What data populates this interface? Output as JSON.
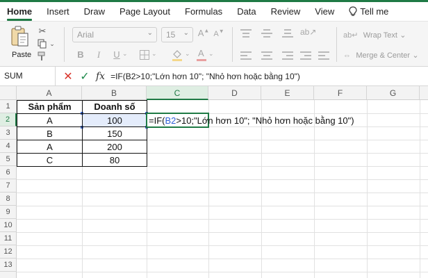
{
  "tabs": [
    "Home",
    "Insert",
    "Draw",
    "Page Layout",
    "Formulas",
    "Data",
    "Review",
    "View"
  ],
  "tell_me": "Tell me",
  "ribbon": {
    "paste_label": "Paste",
    "font_name": "Arial",
    "font_size": "15",
    "bold": "B",
    "italic": "I",
    "underline": "U",
    "wrap_text": "Wrap Text",
    "merge_center": "Merge & Center"
  },
  "formula_bar": {
    "name_box": "SUM",
    "fx": "fx",
    "formula": "=IF(B2>10;\"Lớn hơn 10\"; \"Nhỏ hơn hoặc bằng 10\")"
  },
  "columns": [
    "A",
    "B",
    "C",
    "D",
    "E",
    "F",
    "G"
  ],
  "rows": [
    "1",
    "2",
    "3",
    "4",
    "5",
    "6",
    "7",
    "8",
    "9",
    "10",
    "11",
    "12",
    "13"
  ],
  "table": {
    "headers": [
      "Sản phẩm",
      "Doanh số"
    ],
    "rows": [
      [
        "A",
        "100"
      ],
      [
        "B",
        "150"
      ],
      [
        "A",
        "200"
      ],
      [
        "C",
        "80"
      ]
    ]
  },
  "editing_cell": {
    "part1": "=IF(",
    "ref": "B2",
    "part2": ">10;\"Lớn hơn 10\"; \"Nhỏ hơn hoặc bằng 10\")"
  },
  "colors": {
    "accent": "#1f7a45",
    "reference_blue": "#2e5fd6",
    "cancel_red": "#d9342b",
    "enter_green": "#1f8a4c"
  }
}
